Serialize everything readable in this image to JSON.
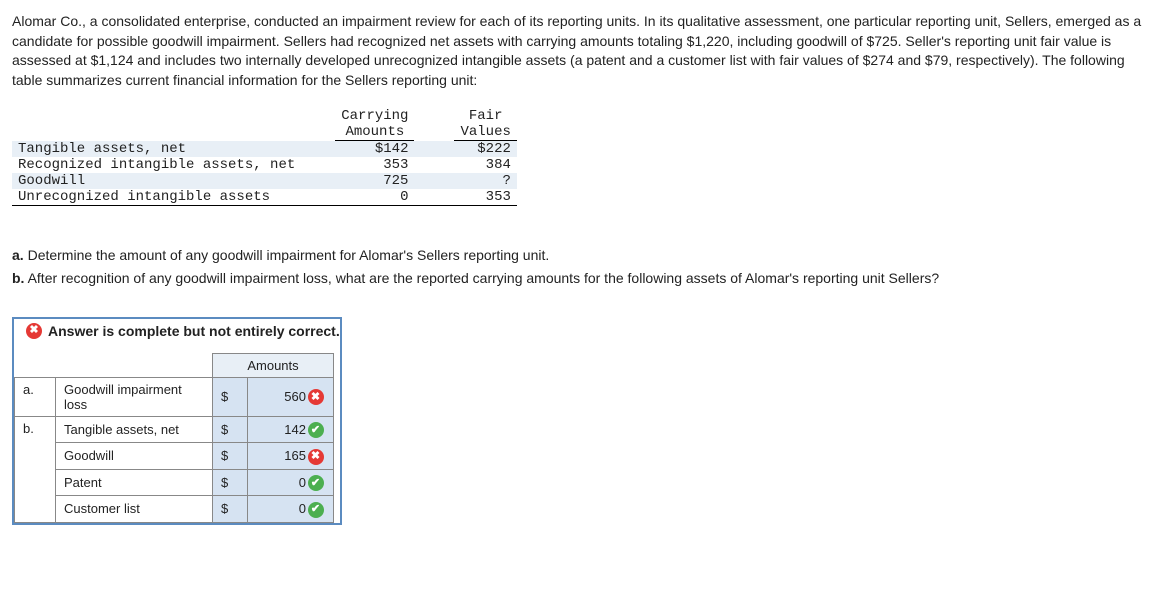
{
  "description": "Alomar Co., a consolidated enterprise, conducted an impairment review for each of its reporting units. In its qualitative assessment, one particular reporting unit, Sellers, emerged as a candidate for possible goodwill impairment. Sellers had recognized net assets with carrying amounts totaling $1,220, including goodwill of $725. Seller's reporting unit fair value is assessed at $1,124 and includes two internally developed unrecognized intangible assets (a patent and a customer list with fair values of $274 and $79, respectively). The following table summarizes current financial information for the Sellers reporting unit:",
  "data_table": {
    "head_col1": "Carrying Amounts",
    "head_col2": "Fair Values",
    "rows": [
      {
        "label": "Tangible assets, net",
        "carrying": "$142",
        "fair": "$222"
      },
      {
        "label": "Recognized intangible assets, net",
        "carrying": "353",
        "fair": "384"
      },
      {
        "label": "Goodwill",
        "carrying": "725",
        "fair": "?"
      },
      {
        "label": "Unrecognized intangible assets",
        "carrying": "0",
        "fair": "353"
      }
    ]
  },
  "questions": {
    "a_label": "a.",
    "a_text": " Determine the amount of any goodwill impairment for Alomar's Sellers reporting unit.",
    "b_label": "b.",
    "b_text": " After recognition of any goodwill impairment loss, what are the reported carrying amounts for the following assets of Alomar's reporting unit Sellers?"
  },
  "banner": {
    "icon": "✖",
    "text": "Answer is complete but not entirely correct."
  },
  "answer_table": {
    "header_amounts": "Amounts",
    "rows": [
      {
        "letter": "a.",
        "label": "Goodwill impairment loss",
        "cur": "$",
        "amt": "560",
        "correct": false
      },
      {
        "letter": "b.",
        "label": "Tangible assets, net",
        "cur": "$",
        "amt": "142",
        "correct": true
      },
      {
        "letter": "",
        "label": "Goodwill",
        "cur": "$",
        "amt": "165",
        "correct": false
      },
      {
        "letter": "",
        "label": "Patent",
        "cur": "$",
        "amt": "0",
        "correct": true
      },
      {
        "letter": "",
        "label": "Customer list",
        "cur": "$",
        "amt": "0",
        "correct": true
      }
    ]
  }
}
